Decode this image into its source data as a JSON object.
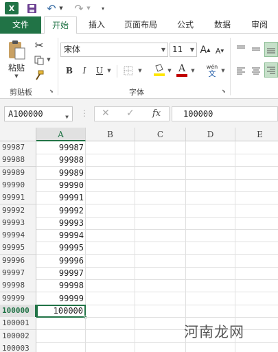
{
  "qat": {
    "logo": "X",
    "icons": [
      "excel-logo-icon",
      "save-icon",
      "undo-icon",
      "redo-icon",
      "customize-qat-icon"
    ]
  },
  "tabs": [
    "文件",
    "开始",
    "插入",
    "页面布局",
    "公式",
    "数据",
    "审阅"
  ],
  "active_tab": "开始",
  "ribbon": {
    "clipboard": {
      "paste_label": "粘贴",
      "group_label": "剪贴板"
    },
    "font": {
      "font_name": "宋体",
      "font_size": "11",
      "group_label": "字体",
      "bold": "B",
      "italic": "I",
      "underline": "U",
      "phonetic": "wén"
    }
  },
  "formula_bar": {
    "name_box": "A100000",
    "fx": "fx",
    "value": "100000"
  },
  "grid": {
    "columns": [
      "A",
      "B",
      "C",
      "D",
      "E"
    ],
    "selected_column": "A",
    "rows": [
      {
        "header": "99987",
        "a": "99987"
      },
      {
        "header": "99988",
        "a": "99988"
      },
      {
        "header": "99989",
        "a": "99989"
      },
      {
        "header": "99990",
        "a": "99990"
      },
      {
        "header": "99991",
        "a": "99991"
      },
      {
        "header": "99992",
        "a": "99992"
      },
      {
        "header": "99993",
        "a": "99993"
      },
      {
        "header": "99994",
        "a": "99994"
      },
      {
        "header": "99995",
        "a": "99995"
      },
      {
        "header": "99996",
        "a": "99996"
      },
      {
        "header": "99997",
        "a": "99997"
      },
      {
        "header": "99998",
        "a": "99998"
      },
      {
        "header": "99999",
        "a": "99999"
      },
      {
        "header": "100000",
        "a": "100000",
        "active": true
      },
      {
        "header": "100001",
        "a": ""
      },
      {
        "header": "100002",
        "a": ""
      },
      {
        "header": "100003",
        "a": ""
      }
    ]
  },
  "watermark": "河南龙网",
  "colors": {
    "accent": "#217346",
    "font_color": "#c00000",
    "highlight": "#ffe600"
  }
}
